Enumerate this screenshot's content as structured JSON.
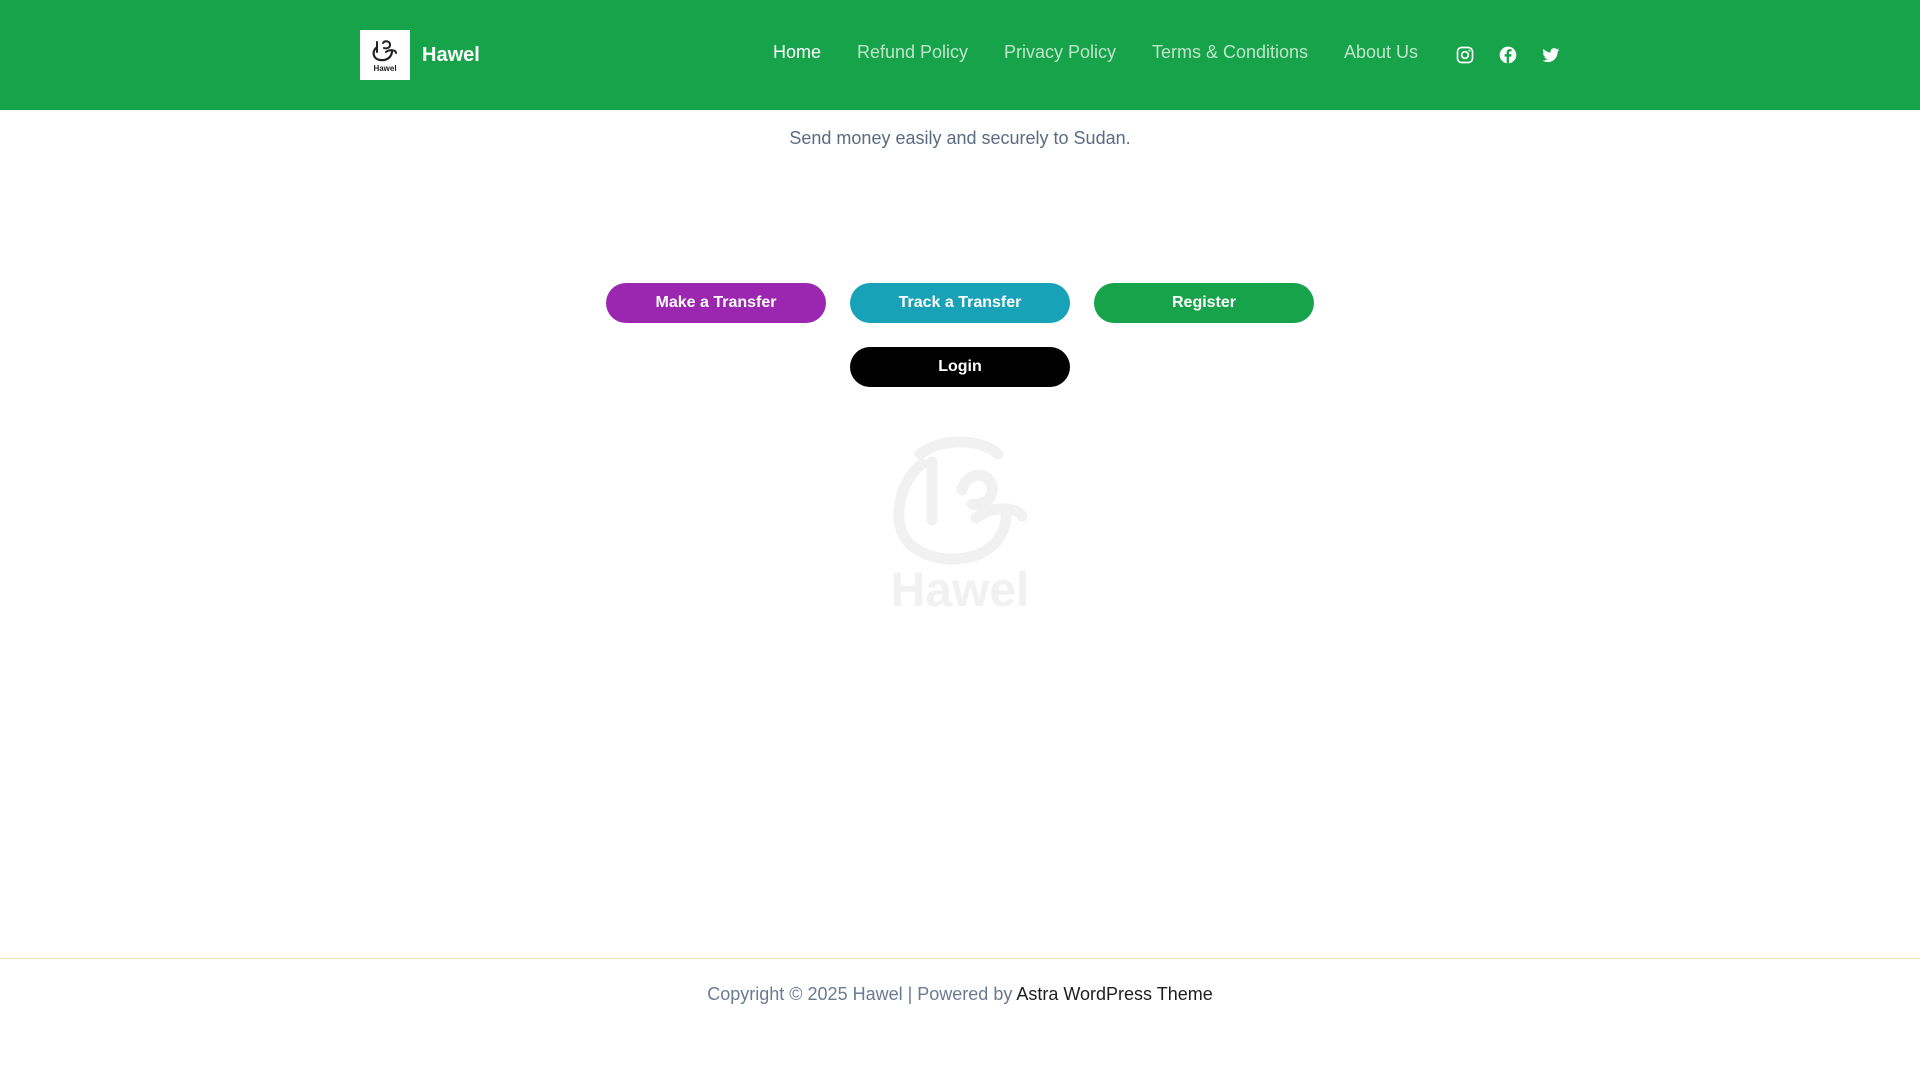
{
  "header": {
    "site_name": "Hawel",
    "logo_text": "Hawel",
    "bg_color": "#17a34a",
    "nav": [
      {
        "label": "Home",
        "active": true
      },
      {
        "label": "Refund Policy",
        "active": false
      },
      {
        "label": "Privacy Policy",
        "active": false
      },
      {
        "label": "Terms & Conditions",
        "active": false
      },
      {
        "label": "About Us",
        "active": false
      }
    ],
    "social_icons": [
      "instagram-icon",
      "facebook-icon",
      "twitter-icon"
    ]
  },
  "main": {
    "tagline": "Send money easily and securely to Sudan.",
    "buttons": {
      "make_transfer": {
        "label": "Make a Transfer",
        "color": "#9b27b0"
      },
      "track_transfer": {
        "label": "Track a Transfer",
        "color": "#17a2b8"
      },
      "register": {
        "label": "Register",
        "color": "#17a34a"
      },
      "login": {
        "label": "Login",
        "color": "#000000"
      }
    },
    "watermark_text": "Hawel"
  },
  "footer": {
    "copyright": "Copyright © 2025 Hawel | Powered by ",
    "theme_link": "Astra WordPress Theme"
  }
}
